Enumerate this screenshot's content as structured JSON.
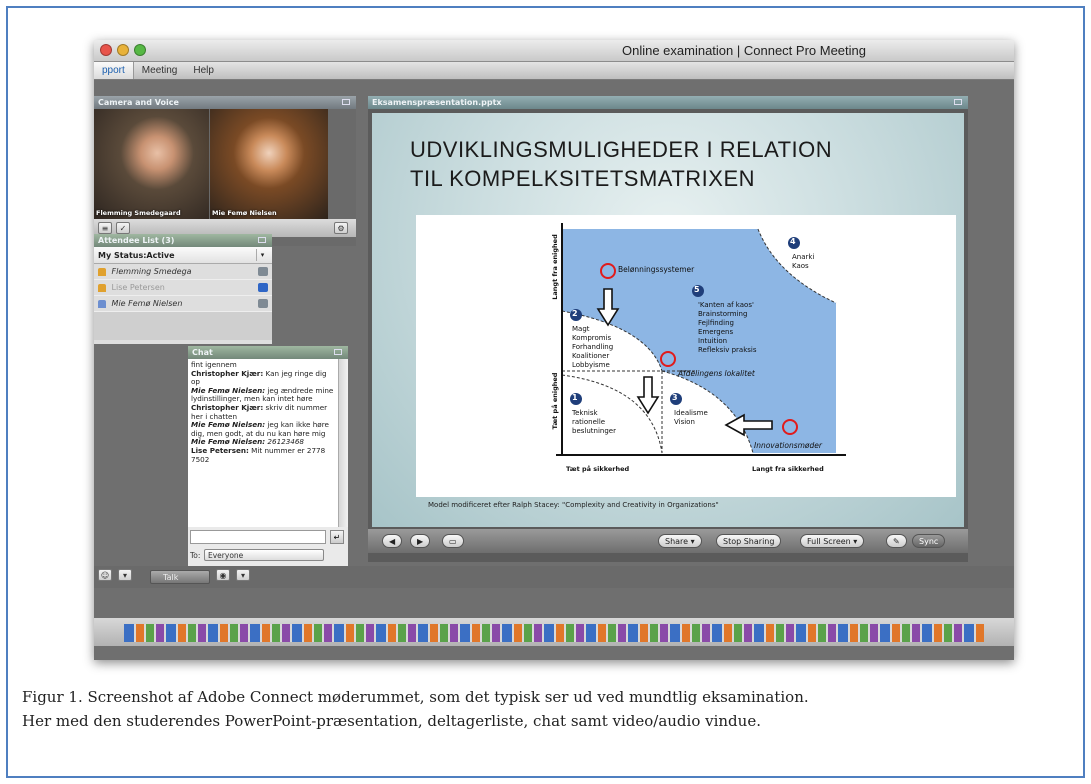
{
  "window": {
    "title": "Online examination | Connect Pro Meeting"
  },
  "menu": {
    "items": [
      "pport",
      "Meeting",
      "Help"
    ]
  },
  "camera_pod": {
    "title": "Camera and Voice",
    "participant_1": "Flemming Smedegaard",
    "participant_2": "Mie Femø Nielsen"
  },
  "attendees_pod": {
    "title": "Attendee List (3)",
    "status": "My Status:Active",
    "attendees": [
      "Flemming Smedega",
      "Lise Petersen",
      "Mie Femø Nielsen"
    ]
  },
  "chat_pod": {
    "title": "Chat",
    "messages": [
      {
        "who": "",
        "text": "fint igennem"
      },
      {
        "who": "Christopher Kjær:",
        "text": "Kan jeg ringe dig op"
      },
      {
        "who": "Mie Femø Nielsen:",
        "text": "jeg ændrede mine lydinstillinger, men kan intet høre"
      },
      {
        "who": "Christopher Kjær:",
        "text": "skriv dit nummer her i chatten"
      },
      {
        "who": "Mie Femø Nielsen:",
        "text": "jeg kan ikke høre dig, men godt, at du nu kan høre mig"
      },
      {
        "who": "Mie Femø Nielsen:",
        "text": "26123468"
      },
      {
        "who": "Lise Petersen:",
        "text": "Mit nummer er 2778 7502"
      }
    ],
    "to_label": "To:",
    "to_value": "Everyone"
  },
  "share_pod": {
    "title": "Eksamenspræsentation.pptx",
    "slide_title_line1": "UDVIKLINGSMULIGHEDER I RELATION",
    "slide_title_line2": "TIL KOMPELKSITETSMATRIXEN",
    "matrix": {
      "y_top": "Langt fra enighed",
      "y_bottom": "Tæt på enighed",
      "x_left": "Tæt på sikkerhed",
      "x_right": "Langt fra sikkerhed",
      "zone1_num": "1",
      "zone1_lines": [
        "Teknisk",
        "rationelle",
        "beslutninger"
      ],
      "zone2_num": "2",
      "zone2_lines": [
        "Magt",
        "Kompromis",
        "Forhandling",
        "Koalitioner",
        "Lobbyisme"
      ],
      "zone3_num": "3",
      "zone3_lines": [
        "Idealisme",
        "Vision"
      ],
      "zone4_num": "4",
      "zone4_lines": [
        "Anarki",
        "Kaos"
      ],
      "zone5_num": "5",
      "zone5_lines": [
        "'Kanten af kaos'",
        "Brainstorming",
        "Fejlfinding",
        "Emergens",
        "Intuition",
        "Refleksiv praksis"
      ],
      "label_beloenning": "Belønningssystemer",
      "label_afdeling": "Afdelingens lokalitet",
      "label_innovation": "Innovationsmøder"
    },
    "slide_caption": "Model modificeret efter Ralph Stacey: \"Complexity and Creativity in Organizations\"",
    "buttons": {
      "share": "Share",
      "stop": "Stop Sharing",
      "fullscreen": "Full Screen",
      "sync": "Sync"
    }
  },
  "bottom": {
    "talk": "Talk"
  },
  "figure_caption": {
    "line1": "Figur 1. Screenshot af Adobe Connect møderummet, som det typisk ser ud ved mundtlig eksamination.",
    "line2": "Her med den studerendes PowerPoint-præsentation, deltagerliste, chat samt video/audio vindue."
  },
  "colors": {
    "zone_blue": "#8db6e4",
    "marker_red": "#e11b1b",
    "frame_blue": "#4f7fc0"
  }
}
